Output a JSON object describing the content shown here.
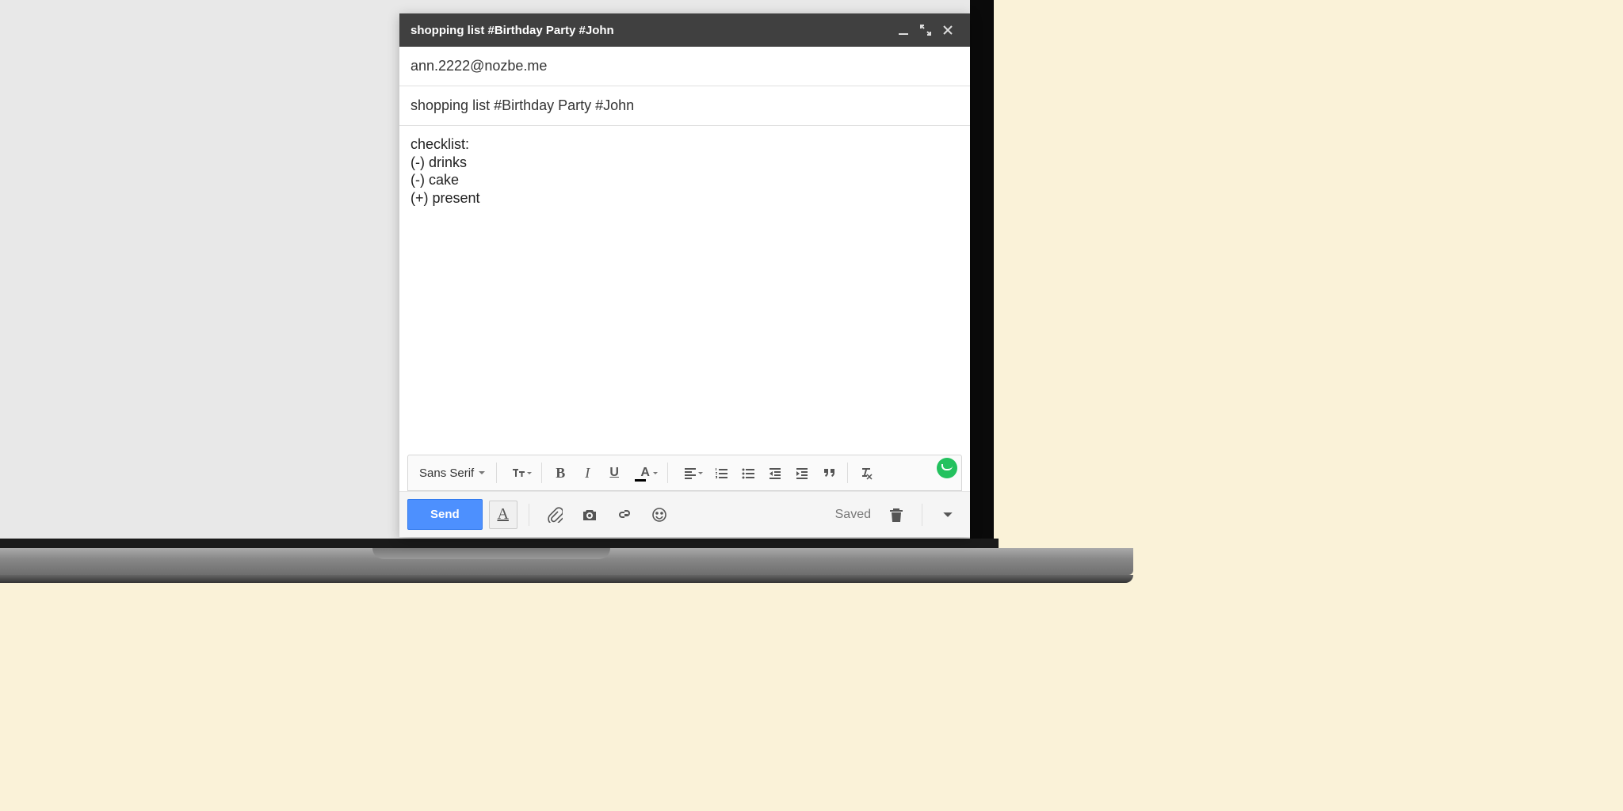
{
  "compose": {
    "title": "shopping list #Birthday Party #John",
    "to": "ann.2222@nozbe.me",
    "subject": "shopping list #Birthday Party #John",
    "body": "checklist:\n(-) drinks\n(-) cake\n(+) present"
  },
  "format_toolbar": {
    "font_label": "Sans Serif"
  },
  "action_bar": {
    "send_label": "Send",
    "saved_label": "Saved"
  },
  "colors": {
    "titlebar": "#404040",
    "send_button": "#4d90fe",
    "status_green": "#23c15e"
  }
}
